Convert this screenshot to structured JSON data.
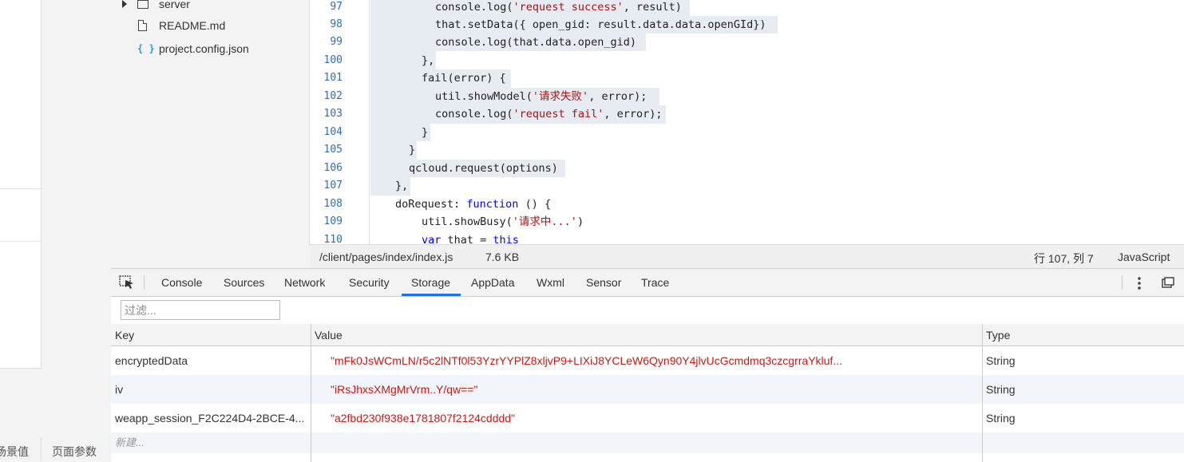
{
  "left_panel": {
    "bottom_tab_left": "场景值",
    "bottom_tab_right": "页面参数"
  },
  "file_tree": {
    "items": [
      {
        "label": "server",
        "icon": "folder-icon"
      },
      {
        "label": "README.md",
        "icon": "file-icon"
      },
      {
        "label": "project.config.json",
        "icon": "json-icon"
      }
    ],
    "json_glyph": "{ }"
  },
  "editor": {
    "line_numbers": [
      "97",
      "98",
      "99",
      "100",
      "101",
      "102",
      "103",
      "104",
      "105",
      "106",
      "107",
      "108",
      "109",
      "110"
    ],
    "lines": {
      "l97": {
        "a": "console.log(",
        "b": "'request success'",
        "c": ", result)"
      },
      "l98": "that.setData({ open_gid: result.data.data.openGId})",
      "l99": "console.log(that.data.open_gid)",
      "l100": "},",
      "l101": "fail(error) {",
      "l102": {
        "a": "util.showModel(",
        "b": "'请求失败'",
        "c": ", error);"
      },
      "l103": {
        "a": "console.log(",
        "b": "'request fail'",
        "c": ", error);"
      },
      "l104": "}",
      "l105": "}",
      "l106": "qcloud.request(options)",
      "l107": "},",
      "l108": {
        "a": "doRequest: ",
        "b": "function",
        "c": " () {"
      },
      "l109": {
        "a": "util.showBusy(",
        "b": "'请求中...'",
        "c": ")"
      },
      "l110": {
        "a": "var",
        "b": " that = ",
        "c": "this"
      }
    }
  },
  "status_bar": {
    "file_path": "/client/pages/index/index.js",
    "file_size": "7.6 KB",
    "cursor": "行 107, 列 7",
    "language": "JavaScript"
  },
  "devtools": {
    "tabs": [
      "Console",
      "Sources",
      "Network",
      "Security",
      "Storage",
      "AppData",
      "Wxml",
      "Sensor",
      "Trace"
    ],
    "active_tab": "Storage",
    "filter_placeholder": "过滤...",
    "columns": {
      "key": "Key",
      "value": "Value",
      "type": "Type"
    },
    "rows": [
      {
        "key": "encryptedData",
        "value": "\"mFk0JsWCmLN/r5c2lNTf0l53YzrYYPlZ8xljvP9+LIXiJ8YCLeW6Qyn90Y4jlvUcGcmdmq3czcgrraYkluf...",
        "type": "String"
      },
      {
        "key": "iv",
        "value": "\"iRsJhxsXMgMrVrm..Y/qw==\"",
        "type": "String"
      },
      {
        "key": "weapp_session_F2C224D4-2BCE-4...",
        "value": "\"a2fbd230f938e1781807f2124cdddd\"",
        "type": "String"
      }
    ],
    "new_row_placeholder": "新建..."
  },
  "colors": {
    "accent": "#1a73e8",
    "string_value": "#c41a16",
    "keyword": "#0000ff",
    "line_number": "#2c6fb5"
  }
}
